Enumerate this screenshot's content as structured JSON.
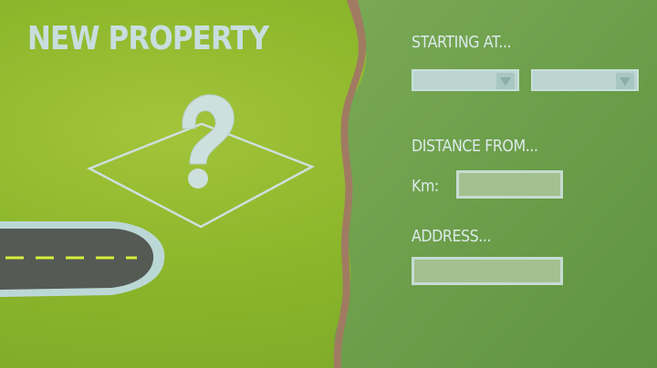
{
  "title": "NEW PROPERTY",
  "form": {
    "starting_label": "STARTING AT...",
    "distance_label": "DISTANCE FROM...",
    "km_label": "Km:",
    "address_label": "ADDRESS..."
  },
  "icons": [
    "question-mark-icon",
    "property-plot-icon",
    "road-icon",
    "dropdown-arrow-icon"
  ],
  "colors": {
    "left_green": "#8bb52a",
    "right_green": "#6e9e45",
    "path_brown": "#a07b62",
    "text": "#dbeaea"
  }
}
